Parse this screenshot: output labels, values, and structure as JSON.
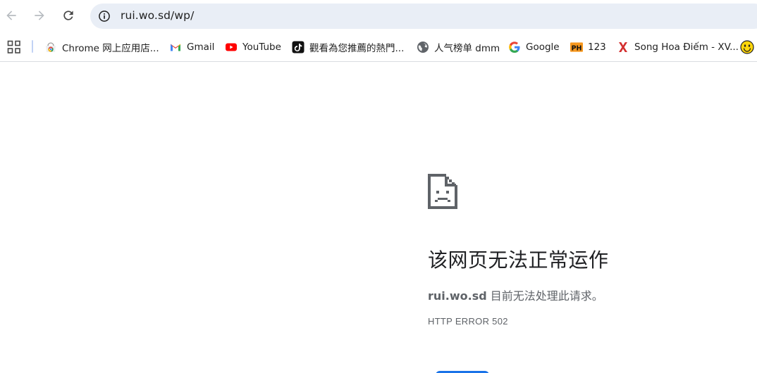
{
  "toolbar": {
    "back_icon": "arrow-back-icon",
    "forward_icon": "arrow-forward-icon",
    "reload_icon": "reload-icon",
    "site_info_icon": "info-icon",
    "url": "rui.wo.sd/wp/"
  },
  "bookmarks": {
    "apps_icon": "apps-grid-icon",
    "items": [
      {
        "label": "Chrome 网上应用店...",
        "icon": "chrome-web-store-icon"
      },
      {
        "label": "Gmail",
        "icon": "gmail-icon"
      },
      {
        "label": "YouTube",
        "icon": "youtube-icon"
      },
      {
        "label": "觀看為您推薦的熱門...",
        "icon": "tiktok-icon"
      },
      {
        "label": "人气榜单 dmm",
        "icon": "globe-icon"
      },
      {
        "label": "Google",
        "icon": "google-icon"
      },
      {
        "label": "123",
        "icon": "ph-icon"
      },
      {
        "label": "Song Hoa Điếm - XV...",
        "icon": "x-icon"
      },
      {
        "label": "",
        "icon": "smiley-icon"
      }
    ]
  },
  "error": {
    "icon": "sad-page-icon",
    "title": "该网页无法正常运作",
    "host": "rui.wo.sd",
    "message": " 目前无法处理此请求。",
    "code": "HTTP ERROR 502"
  },
  "colors": {
    "omnibox_bg": "#e9eef6",
    "accent": "#1a73e8",
    "text_secondary": "#5f6368"
  }
}
